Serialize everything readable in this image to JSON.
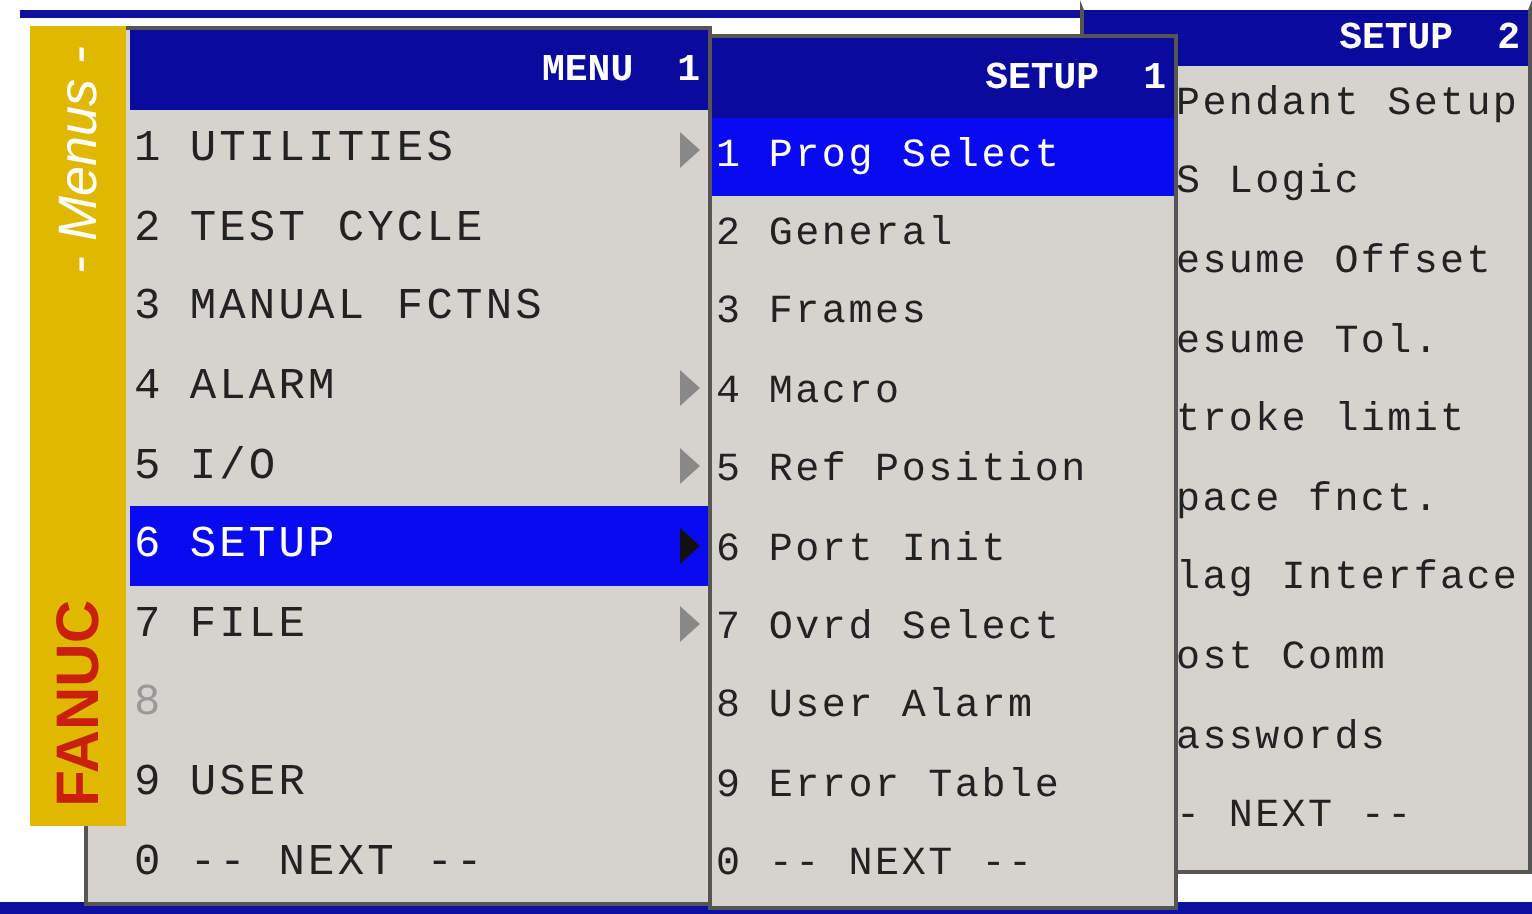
{
  "sidebar": {
    "caption": "- Menus -",
    "brand": "FANUC"
  },
  "menus": [
    {
      "title": "MENU",
      "page": "1",
      "items": [
        {
          "number": "1",
          "label": "UTILITIES",
          "submenu": true,
          "selected": false,
          "disabled": false
        },
        {
          "number": "2",
          "label": "TEST CYCLE",
          "submenu": false,
          "selected": false,
          "disabled": false
        },
        {
          "number": "3",
          "label": "MANUAL FCTNS",
          "submenu": false,
          "selected": false,
          "disabled": false
        },
        {
          "number": "4",
          "label": "ALARM",
          "submenu": true,
          "selected": false,
          "disabled": false
        },
        {
          "number": "5",
          "label": "I/O",
          "submenu": true,
          "selected": false,
          "disabled": false
        },
        {
          "number": "6",
          "label": "SETUP",
          "submenu": true,
          "selected": true,
          "disabled": false
        },
        {
          "number": "7",
          "label": "FILE",
          "submenu": true,
          "selected": false,
          "disabled": false
        },
        {
          "number": "8",
          "submenu": false,
          "selected": false,
          "disabled": true
        },
        {
          "number": "9",
          "label": "USER",
          "submenu": false,
          "selected": false,
          "disabled": false
        },
        {
          "number": "0",
          "label": "-- NEXT --",
          "submenu": false,
          "selected": false,
          "disabled": false
        }
      ]
    },
    {
      "title": "SETUP",
      "page": "1",
      "items": [
        {
          "number": "1",
          "label": "Prog Select",
          "selected": true
        },
        {
          "number": "2",
          "label": "General",
          "selected": false
        },
        {
          "number": "3",
          "label": "Frames",
          "selected": false
        },
        {
          "number": "4",
          "label": "Macro",
          "selected": false
        },
        {
          "number": "5",
          "label": "Ref Position",
          "selected": false
        },
        {
          "number": "6",
          "label": "Port Init",
          "selected": false
        },
        {
          "number": "7",
          "label": "Ovrd Select",
          "selected": false
        },
        {
          "number": "8",
          "label": "User Alarm",
          "selected": false
        },
        {
          "number": "9",
          "label": "Error Table",
          "selected": false
        },
        {
          "number": "0",
          "label": "-- NEXT --",
          "selected": false
        }
      ]
    },
    {
      "title": "SETUP",
      "page": "2",
      "items": [
        {
          "label": "Pendant Setup",
          "selected": false
        },
        {
          "label": "S Logic",
          "selected": false
        },
        {
          "label": "esume Offset",
          "selected": false
        },
        {
          "label": "esume Tol.",
          "selected": false
        },
        {
          "label": "troke limit",
          "selected": false
        },
        {
          "label": "pace fnct.",
          "selected": false
        },
        {
          "label": "lag Interface",
          "selected": false
        },
        {
          "label": "ost Comm",
          "selected": false
        },
        {
          "label": "asswords",
          "selected": false
        },
        {
          "label": "- NEXT --",
          "selected": false
        }
      ]
    }
  ]
}
